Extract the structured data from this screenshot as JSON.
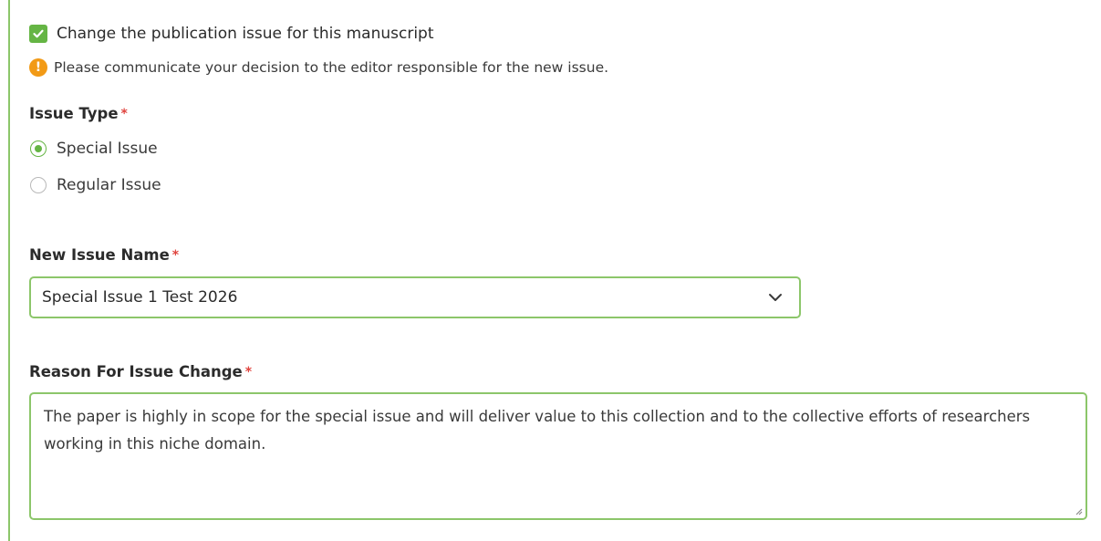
{
  "checkbox": {
    "label": "Change the publication issue for this manuscript",
    "checked": true
  },
  "warning": {
    "icon": "exclamation-circle-icon",
    "text": "Please communicate your decision to the editor responsible for the new issue."
  },
  "issue_type": {
    "label": "Issue Type",
    "required_marker": "*",
    "options": [
      {
        "label": "Special Issue",
        "selected": true
      },
      {
        "label": "Regular Issue",
        "selected": false
      }
    ]
  },
  "new_issue_name": {
    "label": "New Issue Name",
    "required_marker": "*",
    "value": "Special Issue 1 Test 2026"
  },
  "reason": {
    "label": "Reason For Issue Change",
    "required_marker": "*",
    "value": "The paper is highly in scope for the special issue and will deliver value to this collection and to the collective efforts of researchers working in this niche domain."
  },
  "colors": {
    "accent": "#65b544",
    "border": "#8cc66a",
    "warning": "#f29a16",
    "required": "#e0443f"
  }
}
